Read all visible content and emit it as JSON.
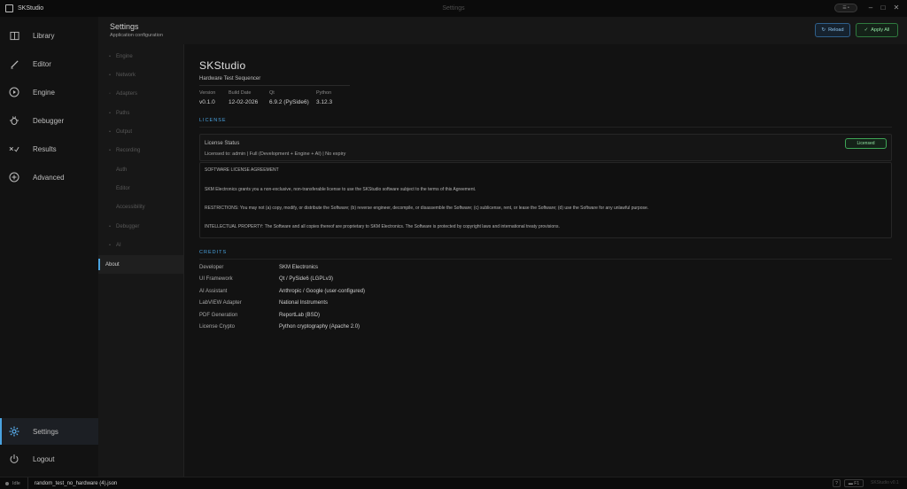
{
  "window": {
    "app_name": "SKStudio",
    "title": "Settings",
    "pill": "☰ •",
    "minimize": "–",
    "maximize": "□",
    "close": "✕"
  },
  "nav": {
    "items": [
      {
        "label": "Library",
        "icon": "book-icon"
      },
      {
        "label": "Editor",
        "icon": "pencil-icon"
      },
      {
        "label": "Engine",
        "icon": "play-circle-icon"
      },
      {
        "label": "Debugger",
        "icon": "bug-icon"
      },
      {
        "label": "Results",
        "icon": "check-results-icon"
      },
      {
        "label": "Advanced",
        "icon": "plus-circle-icon"
      }
    ],
    "settings_label": "Settings",
    "logout_label": "Logout"
  },
  "header": {
    "title": "Settings",
    "subtitle": "Application configuration",
    "reload_label": "Reload",
    "reload_icon": "↻",
    "apply_label": "Apply All",
    "apply_icon": "✓"
  },
  "settings_menu": {
    "items": [
      {
        "label": "Engine",
        "marker": "•"
      },
      {
        "label": "Network",
        "marker": "•"
      },
      {
        "label": "Adapters",
        "marker": "▫"
      },
      {
        "label": "Paths",
        "marker": "•"
      },
      {
        "label": "Output",
        "marker": "•"
      },
      {
        "label": "Recording",
        "marker": "•"
      },
      {
        "label": "Auth",
        "marker": ""
      },
      {
        "label": "Editor",
        "marker": ""
      },
      {
        "label": "Accessibility",
        "marker": ""
      },
      {
        "label": "Debugger",
        "marker": "•"
      },
      {
        "label": "AI",
        "marker": "•"
      },
      {
        "label": "About",
        "marker": ""
      }
    ],
    "active": "About"
  },
  "about": {
    "product": "SKStudio",
    "tagline": "Hardware Test Sequencer",
    "meta": [
      {
        "key": "Version",
        "value": "v0.1.0"
      },
      {
        "key": "Build Date",
        "value": "12-02-2026"
      },
      {
        "key": "Qt",
        "value": "6.9.2 (PySide6)"
      },
      {
        "key": "Python",
        "value": "3.12.3"
      }
    ]
  },
  "license": {
    "section_title": "LICENSE",
    "status_label": "License Status",
    "status_detail": "Licensed to: admin | Full (Development + Engine + AI) | No expiry",
    "badge": "Licensed",
    "agreement": [
      "SOFTWARE LICENSE AGREEMENT",
      "SKM Electronics grants you a non-exclusive, non-transferable license to use the SKStudio software subject to the terms of this Agreement.",
      "RESTRICTIONS: You may not (a) copy, modify, or distribute the Software; (b) reverse engineer, decompile, or disassemble the Software; (c) sublicense, rent, or lease the Software; (d) use the Software for any unlawful purpose.",
      "INTELLECTUAL PROPERTY: The Software and all copies thereof are proprietary to SKM Electronics. The Software is protected by copyright laws and international treaty provisions."
    ]
  },
  "credits": {
    "section_title": "CREDITS",
    "rows": [
      {
        "key": "Developer",
        "value": "SKM Electronics"
      },
      {
        "key": "UI Framework",
        "value": "Qt / PySide6 (LGPLv3)"
      },
      {
        "key": "AI Assistant",
        "value": "Anthropic / Google (user-configured)"
      },
      {
        "key": "LabVIEW Adapter",
        "value": "National Instruments"
      },
      {
        "key": "PDF Generation",
        "value": "ReportLab (BSD)"
      },
      {
        "key": "License Crypto",
        "value": "Python cryptography (Apache 2.0)"
      }
    ]
  },
  "status_bar": {
    "state": "Idle",
    "file": "random_test_no_hardware (4).json",
    "help": "?",
    "badge": "▬ F1",
    "version": "SKStudio v0.1"
  },
  "colors": {
    "accent": "#4aa3e0",
    "success": "#3ea556",
    "background": "#121212"
  }
}
